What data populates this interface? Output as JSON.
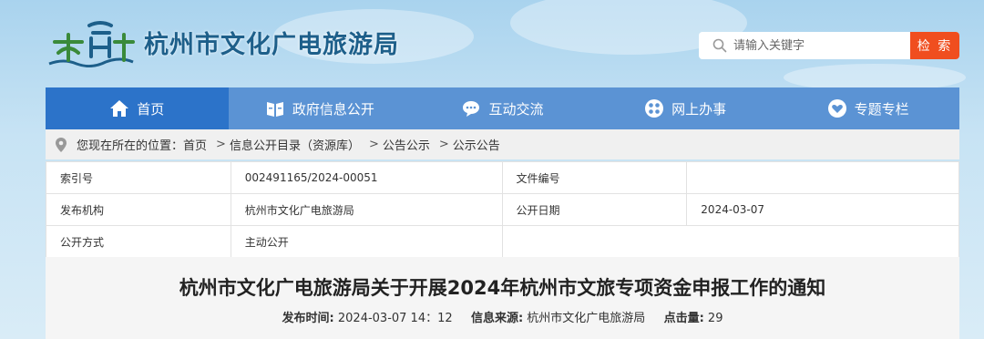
{
  "header": {
    "site_name": "杭州市文化广电旅游局",
    "search": {
      "placeholder": "请输入关键字",
      "button_label": "检 索"
    }
  },
  "nav": {
    "items": [
      {
        "label": "首页",
        "icon": "home-icon",
        "active": true
      },
      {
        "label": "政府信息公开",
        "icon": "info-card-icon",
        "active": false
      },
      {
        "label": "互动交流",
        "icon": "chat-bubble-icon",
        "active": false
      },
      {
        "label": "网上办事",
        "icon": "grid-apps-icon",
        "active": false
      },
      {
        "label": "专题专栏",
        "icon": "heart-badge-icon",
        "active": false
      }
    ]
  },
  "breadcrumb": {
    "prefix": "您现在所在的位置：",
    "items": [
      "首页",
      "信息公开目录（资源库）",
      "公告公示",
      "公示公告"
    ]
  },
  "info": {
    "index_no_label": "索引号",
    "index_no_value": "002491165/2024-00051",
    "doc_no_label": "文件编号",
    "doc_no_value": "",
    "publisher_label": "发布机构",
    "publisher_value": "杭州市文化广电旅游局",
    "public_date_label": "公开日期",
    "public_date_value": "2024-03-07",
    "public_mode_label": "公开方式",
    "public_mode_value": "主动公开"
  },
  "article": {
    "title": "杭州市文化广电旅游局关于开展2024年杭州市文旅专项资金申报工作的通知",
    "publish_time_label": "发布时间:",
    "publish_time_value": "2024-03-07 14：12",
    "source_label": "信息来源:",
    "source_value": "杭州市文化广电旅游局",
    "hits_label": "点击量:",
    "hits_value": "29"
  },
  "colors": {
    "nav_bg": "#5b93d4",
    "nav_active": "#2c73c9",
    "search_button": "#f04e1f",
    "site_name": "#1d5f8a"
  }
}
